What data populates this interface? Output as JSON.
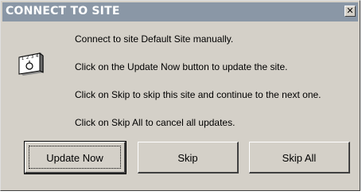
{
  "dialog": {
    "title": "CONNECT TO SITE",
    "close_glyph": "✕",
    "icon": "phone-dial-icon",
    "icon_digits": [
      "1",
      "2",
      "3",
      "4"
    ],
    "messages": [
      "Connect to site Default Site manually.",
      "Click on the Update Now button to update the site.",
      "Click on Skip to skip this site and continue to the next one.",
      "Click on Skip All to cancel all updates."
    ],
    "buttons": {
      "update_now": "Update Now",
      "skip": "Skip",
      "skip_all": "Skip All"
    }
  }
}
